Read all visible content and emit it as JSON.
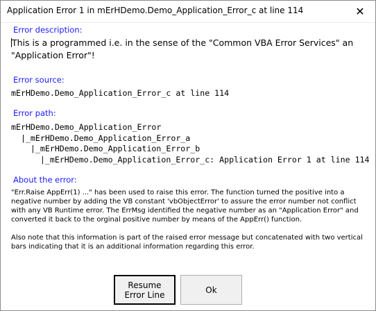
{
  "window": {
    "title": "Application Error 1 in mErHDemo.Demo_Application_Error_c at line 114",
    "close_icon": "close-icon"
  },
  "description": {
    "label": "Error description:",
    "text": "This is a programmed i.e. in the sense of the \"Common VBA Error Services\" an \"Application Error\"!"
  },
  "source": {
    "label": "Error source:",
    "text": "mErHDemo.Demo_Application_Error_c at line 114"
  },
  "path": {
    "label": "Error path:",
    "lines": [
      "mErHDemo.Demo_Application_Error",
      "  |_mErHDemo.Demo_Application_Error_a",
      "    |_mErHDemo.Demo_Application_Error_b",
      "      |_mErHDemo.Demo_Application_Error_c: Application Error 1 at line 114"
    ]
  },
  "about": {
    "label": "About the error:",
    "paragraphs": [
      "\"Err.Raise AppErr(1) ...\" has been used to raise this error. The function turned the positive into a negative number by adding the VB constant 'vbObjectError' to assure the error number not conflict with any VB Runtime error. The ErrMsg identified the negative number as an \"Application Error\" and converted it back to the orginal positive number by means of the AppErr() function.",
      "Also note that this information is part of the raised error message but concatenated with two vertical bars indicating that it is an additional information regarding this error."
    ]
  },
  "buttons": {
    "resume": "Resume\nError Line",
    "ok": "Ok"
  }
}
